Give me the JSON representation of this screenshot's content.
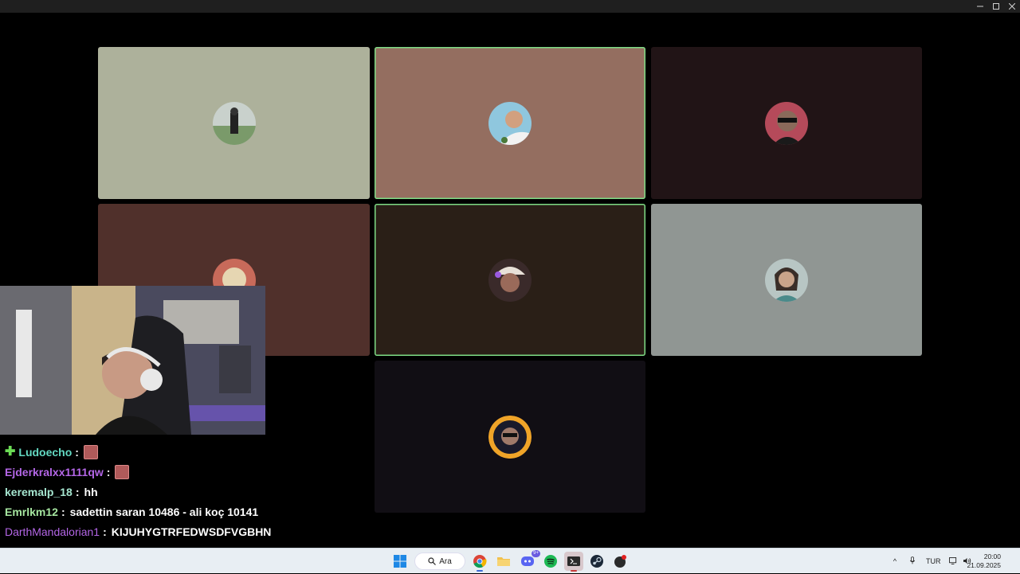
{
  "window": {
    "controls": [
      "minimize",
      "maximize",
      "close"
    ]
  },
  "participants": [
    {
      "id": "p1",
      "tile_color": "#adb19b",
      "speaking": false,
      "avatar_color": "#8a9a8a"
    },
    {
      "id": "p2",
      "tile_color": "#946e60",
      "speaking": true,
      "avatar_color": "#b58f7c"
    },
    {
      "id": "p3",
      "tile_color": "#211416",
      "speaking": false,
      "avatar_color": "#5a3a34"
    },
    {
      "id": "p4",
      "tile_color": "#50302b",
      "speaking": false,
      "avatar_color": "#d8c9b8"
    },
    {
      "id": "p5",
      "tile_color": "#2a1f17",
      "speaking": true,
      "avatar_color": "#6a4a5a"
    },
    {
      "id": "p6",
      "tile_color": "#909693",
      "speaking": false,
      "avatar_color": "#7a8a88"
    },
    {
      "id": "p7",
      "tile_color": "#110e14",
      "speaking": false,
      "avatar_color": "#e2a63a"
    }
  ],
  "chat": {
    "messages": [
      {
        "user": "Ludoecho",
        "user_color": "#63d9c2",
        "text": "",
        "emote": true,
        "badge": "plus"
      },
      {
        "user": "Ejderkralxx1111qw",
        "user_color": "#b366e6",
        "text": "",
        "emote": true,
        "badge": ""
      },
      {
        "user": "keremalp_18",
        "user_color": "#a6e6d0",
        "text": "hh",
        "emote": false,
        "badge": ""
      },
      {
        "user": "Emrlkm12",
        "user_color": "#a6e6a0",
        "text": "sadettin saran 10486 - ali koç 10141",
        "emote": false,
        "badge": ""
      },
      {
        "user": "DarthMandalorian1",
        "user_color": "#b366e6",
        "text": "KIJUHYGTRFEDWSDFVGBHN",
        "emote": false,
        "badge": ""
      }
    ],
    "separator": ":"
  },
  "taskbar": {
    "search_label": "Ara",
    "apps": [
      "windows-start",
      "search",
      "chrome",
      "file-explorer",
      "discord",
      "spotify",
      "terminal",
      "steam",
      "unknown-app"
    ],
    "discord_badge": "9+",
    "language": "TUR",
    "time": "20:00",
    "date": "21.09.2025"
  }
}
